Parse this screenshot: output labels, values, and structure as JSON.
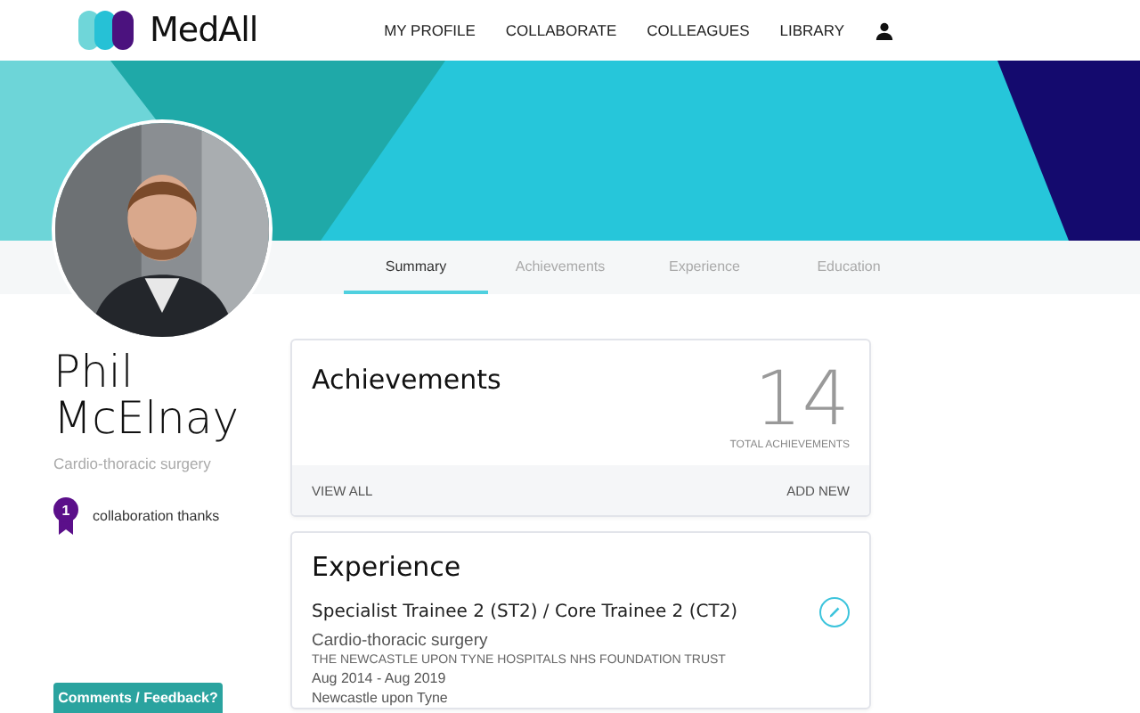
{
  "header": {
    "brand": "MedAll",
    "nav": [
      {
        "label": "MY PROFILE"
      },
      {
        "label": "COLLABORATE"
      },
      {
        "label": "COLLEAGUES"
      },
      {
        "label": "LIBRARY"
      }
    ]
  },
  "tabs": [
    {
      "label": "Summary",
      "selected": true
    },
    {
      "label": "Achievements",
      "selected": false
    },
    {
      "label": "Experience",
      "selected": false
    },
    {
      "label": "Education",
      "selected": false
    }
  ],
  "profile": {
    "name": "Phil McElnay",
    "specialty": "Cardio-thoracic surgery",
    "badges": [
      {
        "count": "1",
        "label": "collaboration thanks"
      }
    ]
  },
  "achievements": {
    "title": "Achievements",
    "total": "14",
    "total_label": "TOTAL ACHIEVEMENTS",
    "actions": [
      "VIEW ALL",
      "ADD NEW"
    ]
  },
  "experience": {
    "title": "Experience",
    "entries": [
      {
        "role": "Specialist Trainee 2 (ST2) / Core Trainee 2 (CT2)",
        "specialty": "Cardio-thoracic surgery",
        "organisation": "THE NEWCASTLE UPON TYNE HOSPITALS NHS FOUNDATION TRUST",
        "dates": "Aug 2014 - Aug 2019",
        "location": "Newcastle upon Tyne"
      }
    ]
  },
  "feedback_button": "Comments / Feedback?"
}
